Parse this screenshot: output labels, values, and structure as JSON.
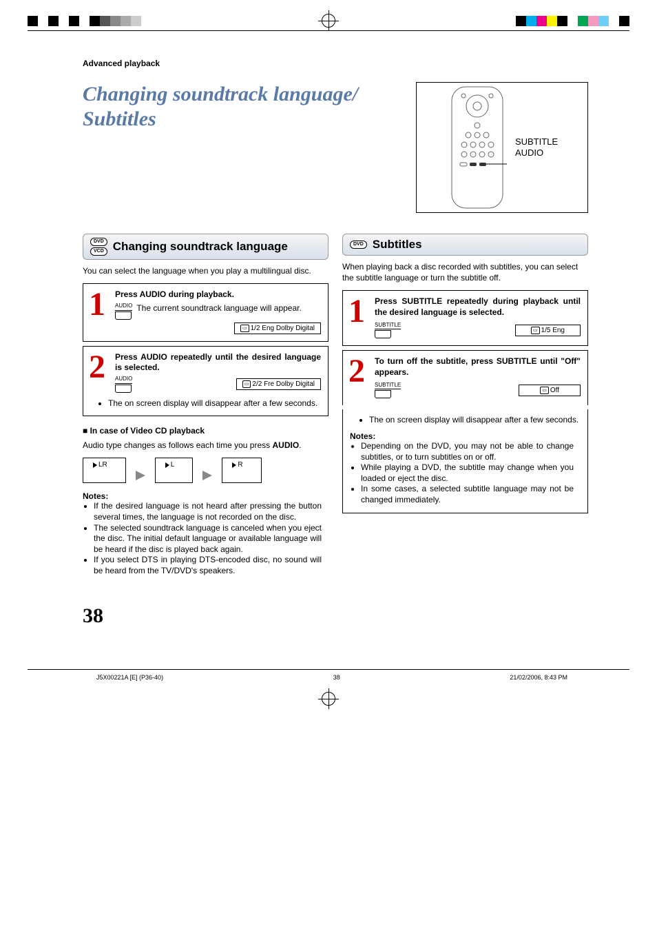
{
  "section_header": "Advanced playback",
  "title_line1": "Changing soundtrack language/",
  "title_line2": "Subtitles",
  "remote": {
    "label1": "SUBTITLE",
    "label2": "AUDIO"
  },
  "left": {
    "title": "Changing soundtrack language",
    "badge1": "DVD",
    "badge2": "VCD",
    "intro": "You can select the language when you play a multilingual disc.",
    "step1": {
      "head": "Press AUDIO during playback.",
      "desc": "The current soundtrack language will appear.",
      "btn": "AUDIO",
      "osd": "1/2 Eng Dolby Digital"
    },
    "step2": {
      "head": "Press AUDIO repeatedly until the desired language is selected.",
      "btn": "AUDIO",
      "osd": "2/2 Fre Dolby Digital",
      "bullet": "The on screen display will disappear after a few seconds."
    },
    "vcd_head": "In case of Video CD playback",
    "vcd_desc_pre": "Audio type changes as follows each time you press ",
    "vcd_desc_bold": "AUDIO",
    "vcd_desc_post": ".",
    "vcd_boxes": [
      "LR",
      "L",
      "R"
    ],
    "notes_head": "Notes:",
    "notes": [
      "If the desired language is not heard after pressing the button several times, the language is not recorded on the disc.",
      "The selected soundtrack language is canceled when you eject the disc. The initial default language or available language will be heard if the disc is played back again.",
      "If you select DTS in playing DTS-encoded disc, no sound will be heard from the TV/DVD's speakers."
    ]
  },
  "right": {
    "title": "Subtitles",
    "badge1": "DVD",
    "intro": "When playing back a disc recorded with subtitles, you can select the subtitle language or turn the subtitle off.",
    "step1": {
      "head": "Press SUBTITLE repeatedly during playback until the desired language is selected.",
      "btn": "SUBTITLE",
      "osd": "1/5 Eng"
    },
    "step2": {
      "head": "To turn off the subtitle, press SUBTITLE until \"Off\" appears.",
      "btn": "SUBTITLE",
      "osd": "Off",
      "bullet": "The on screen display will disappear after a few seconds."
    },
    "notes_head": "Notes:",
    "notes": [
      "Depending on the DVD, you may not be able to change subtitles, or to turn subtitles on or off.",
      "While playing a DVD, the subtitle may change when you loaded or eject the disc.",
      "In some cases, a selected subtitle language may not be changed immediately."
    ]
  },
  "page_number": "38",
  "footer": {
    "left": "J5X00221A [E] (P36-40)",
    "center": "38",
    "right": "21/02/2006, 8:43 PM"
  }
}
